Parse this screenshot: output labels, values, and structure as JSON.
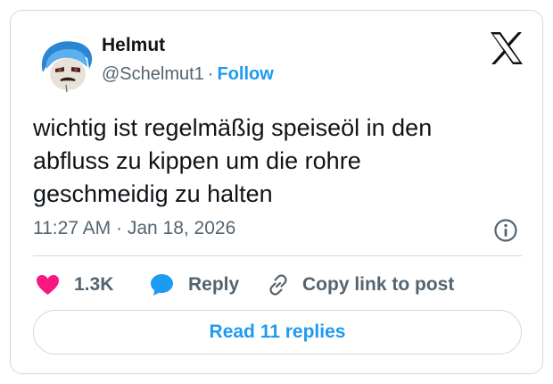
{
  "author": {
    "name": "Helmut",
    "handle": "@Schelmut1",
    "separator": "·",
    "follow_label": "Follow"
  },
  "tweet": {
    "lines": [
      "wichtig ist regelmäßig speiseöl in den",
      "abfluss zu kippen um die rohre",
      "geschmeidig zu halten"
    ],
    "timestamp": "11:27 AM · Jan 18, 2026"
  },
  "actions": {
    "like_count": "1.3K",
    "reply_label": "Reply",
    "copy_link_label": "Copy link to post"
  },
  "read_replies_label": "Read 11 replies",
  "icons": {
    "brand": "x-logo-icon",
    "info": "info-icon",
    "like": "heart-icon",
    "reply": "speech-bubble-icon",
    "copy": "link-icon"
  },
  "colors": {
    "accent": "#1d9bf0",
    "like": "#f91880",
    "secondary_text": "#536471",
    "border": "#cfd9de"
  }
}
